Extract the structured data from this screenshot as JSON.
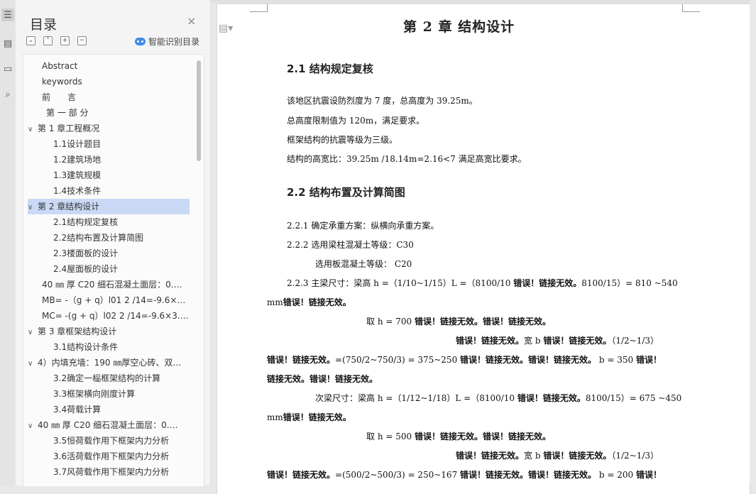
{
  "toc": {
    "title": "目录",
    "close_glyph": "×",
    "smart_label": "智能识别目录",
    "controls": [
      "⌄",
      "⌃",
      "+",
      "−"
    ],
    "items": [
      {
        "label": "Abstract",
        "arrow": ""
      },
      {
        "label": "keywords",
        "arrow": ""
      },
      {
        "label": "前　　言",
        "arrow": ""
      },
      {
        "label": " 第 一 部 分",
        "arrow": ""
      },
      {
        "label": "第 1 章工程概况",
        "arrow": "∨"
      },
      {
        "label": "1.1设计题目",
        "arrow": ""
      },
      {
        "label": "1.2建筑场地",
        "arrow": ""
      },
      {
        "label": "1.3建筑规模",
        "arrow": ""
      },
      {
        "label": "1.4技术条件",
        "arrow": ""
      },
      {
        "label": "第 2 章结构设计",
        "arrow": "∨",
        "selected": true
      },
      {
        "label": "2.1结构规定复核",
        "arrow": ""
      },
      {
        "label": "2.2结构布置及计算简图",
        "arrow": ""
      },
      {
        "label": "2.3楼面板的设计",
        "arrow": ""
      },
      {
        "label": "2.4屋面板的设计",
        "arrow": ""
      },
      {
        "label": "40 ㎜ 厚 C20 细石混凝土面层：0.…",
        "arrow": ""
      },
      {
        "label": "MB= -（g + q）l01 2 /14=-9.6×…",
        "arrow": ""
      },
      {
        "label": "MC= -(g + q）l02 2 /14=-9.6×3.…",
        "arrow": ""
      },
      {
        "label": "第 3 章框架结构设计",
        "arrow": "∨"
      },
      {
        "label": "3.1结构设计条件",
        "arrow": ""
      },
      {
        "label": "4）内填充墙：190 ㎜厚空心砖、双…",
        "arrow": "∨"
      },
      {
        "label": "3.2确定一榀框架结构的计算",
        "arrow": ""
      },
      {
        "label": "3.3框架横向刚度计算",
        "arrow": ""
      },
      {
        "label": "3.4荷载计算",
        "arrow": ""
      },
      {
        "label": "40 ㎜ 厚 C20 细石混凝土面层：0.…",
        "arrow": "∨"
      },
      {
        "label": "3.5恒荷载作用下框架内力分析",
        "arrow": ""
      },
      {
        "label": "3.6活荷载作用下框架内力分析",
        "arrow": ""
      },
      {
        "label": "3.7风荷载作用下框架内力分析",
        "arrow": ""
      }
    ]
  },
  "document": {
    "chapter_title": "第 2 章 结构设计",
    "sec1_title": "2.1 结构规定复核",
    "sec1_lines": [
      "该地区抗震设防烈度为 7 度，总高度为 39.25m。",
      "总高度限制值为 120m，满足要求。",
      "框架结构的抗震等级为三级。",
      "结构的高宽比：39.25m /18.14m=2.16<7 满足高宽比要求。"
    ],
    "sec2_title": "2.2 结构布置及计算简图",
    "l221": "2.2.1 确定承重方案：纵横向承重方案。",
    "l222": "2.2.2 选用梁柱混凝土等级：C30",
    "l222b": "选用板混凝土等级： C20",
    "l223a": "2.2.3 主梁尺寸：梁高 h =（1/10~1/15）L =（8100/10 ",
    "l223a_err": "错误！链接无效。",
    "l223a_tail": "8100/15）= 810 ~540",
    "l223b_pre": "mm",
    "l223b_err": "错误！链接无效。",
    "l223c_pre": "取 h = 700 ",
    "l223c_err": "错误！链接无效。错误！链接无效。",
    "l223d_err1": "错误！链接无效。",
    "l223d_mid": "宽 b ",
    "l223d_err2": "错误！链接无效。",
    "l223d_tail": "（1/2~1/3）",
    "l223e_err1": "错误！链接无效。",
    "l223e_mid": "=(750/2~750/3) = 375~250 ",
    "l223e_err2": "错误！链接无效。错误！链接无效。",
    "l223e_tail": "  b = 350 ",
    "l223e_err3": "错误！",
    "l223f_err": "链接无效。错误！链接无效。",
    "l224a": "次梁尺寸：梁高 h =（1/12~1/18）L =（8100/10 ",
    "l224a_err": "错误！链接无效。",
    "l224a_tail": "8100/15）= 675 ~450",
    "l224b_pre": "mm",
    "l224b_err": "错误！链接无效。",
    "l224c_pre": "取 h = 500 ",
    "l224c_err": "错误！链接无效。错误！链接无效。",
    "l224d_err1": "错误！链接无效。",
    "l224d_mid": "宽 b ",
    "l224d_err2": "错误！链接无效。",
    "l224d_tail": "（1/2~1/3）",
    "l224e_err1": "错误！链接无效。",
    "l224e_mid": "=(500/2~500/3) = 250~167 ",
    "l224e_err2": "错误！链接无效。错误！链接无效。",
    "l224e_tail": "  b = 200 ",
    "l224e_err3": "错误！"
  }
}
